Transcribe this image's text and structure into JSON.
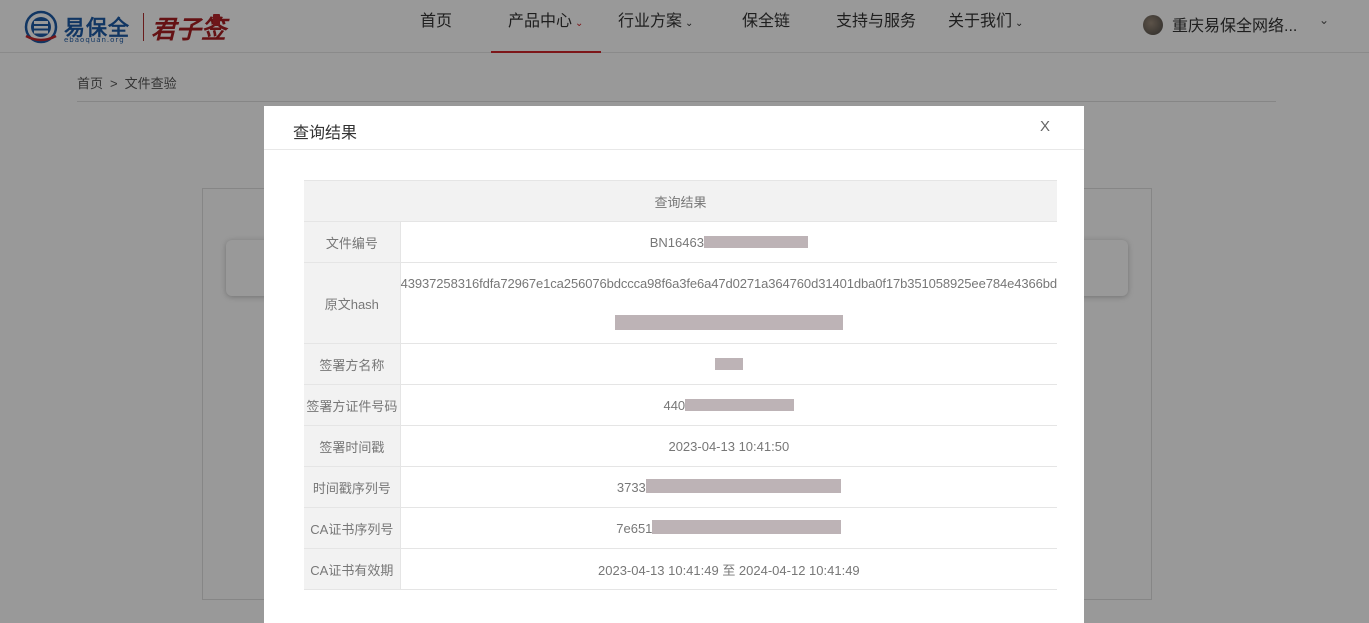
{
  "header": {
    "logo": {
      "cn": "易保全",
      "en": "ebaoquan.org",
      "brand": "君子签"
    },
    "nav": [
      {
        "label": "首页",
        "has_caret": false,
        "active": false
      },
      {
        "label": "产品中心",
        "has_caret": true,
        "active": true
      },
      {
        "label": "行业方案",
        "has_caret": true,
        "active": false
      },
      {
        "label": "保全链",
        "has_caret": false,
        "active": false
      },
      {
        "label": "支持与服务",
        "has_caret": false,
        "active": false
      },
      {
        "label": "关于我们",
        "has_caret": true,
        "active": false
      }
    ],
    "caret_glyph": "⌄",
    "company": "重庆易保全网络..."
  },
  "breadcrumb": {
    "home": "首页",
    "separator": ">",
    "current": "文件查验"
  },
  "modal": {
    "title": "查询结果",
    "close_label": "X",
    "table": {
      "header": "查询结果",
      "rows": [
        {
          "label": "文件编号",
          "value": "BN16463",
          "redacted": true
        },
        {
          "label": "原文hash",
          "value": "43937258316fdfa72967e1ca256076bdccca98f6a3fe6a47d0271a364760d31401dba0f17b351058925ee784e4366bd",
          "redacted": true
        },
        {
          "label": "签署方名称",
          "value": "",
          "redacted": true
        },
        {
          "label": "签署方证件号码",
          "value": "440",
          "redacted": true
        },
        {
          "label": "签署时间戳",
          "value": "2023-04-13 10:41:50",
          "redacted": false
        },
        {
          "label": "时间戳序列号",
          "value": "3733",
          "redacted": true
        },
        {
          "label": "CA证书序列号",
          "value": "7e651",
          "redacted": true
        },
        {
          "label": "CA证书有效期",
          "value": "2023-04-13 10:41:49 至 2024-04-12 10:41:49",
          "redacted": false
        }
      ]
    }
  },
  "colors": {
    "accent": "#d1252b",
    "brand_blue": "#1d5aa6",
    "brand_red": "#a81e22",
    "redaction": "#bdb3b6"
  }
}
